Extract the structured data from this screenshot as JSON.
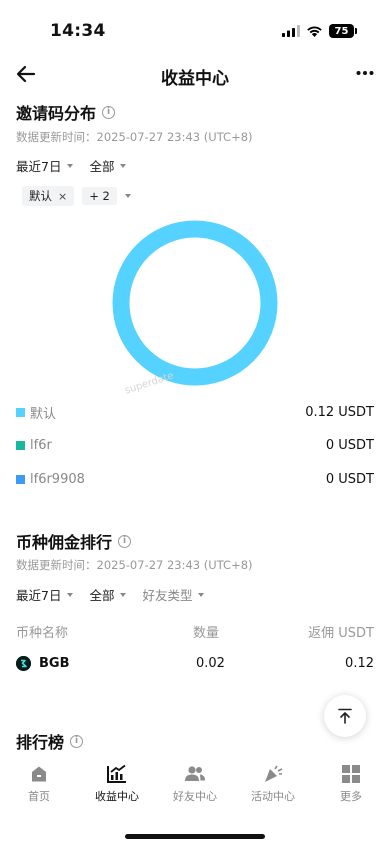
{
  "status_bar": {
    "time": "14:34",
    "battery": "75"
  },
  "nav": {
    "title": "收益中心"
  },
  "invite_section": {
    "title": "邀请码分布",
    "update_time": "数据更新时间：2025-07-27 23:43 (UTC+8)",
    "filters": {
      "period": "最近7日",
      "scope": "全部"
    },
    "tags": {
      "selected": "默认",
      "more": "+ 2"
    },
    "watermark": "superdate",
    "legend": [
      {
        "name": "默认",
        "value": "0.12 USDT",
        "color": "#55d2ff"
      },
      {
        "name": "lf6r",
        "value": "0 USDT",
        "color": "#1ab8a0"
      },
      {
        "name": "lf6r9908",
        "value": "0 USDT",
        "color": "#3d9cf2"
      }
    ]
  },
  "coin_section": {
    "title": "币种佣金排行",
    "update_time": "数据更新时间：2025-07-27 23:43 (UTC+8)",
    "filters": {
      "period": "最近7日",
      "scope": "全部",
      "friend_type": "好友类型"
    },
    "headers": {
      "coin": "币种名称",
      "qty": "数量",
      "rebate": "返佣 USDT"
    },
    "rows": [
      {
        "coin": "BGB",
        "qty": "0.02",
        "rebate": "0.12"
      }
    ]
  },
  "ranking_section": {
    "title": "排行榜"
  },
  "tabbar": {
    "home": "首页",
    "earnings": "收益中心",
    "friends": "好友中心",
    "activity": "活动中心",
    "more": "更多"
  }
}
